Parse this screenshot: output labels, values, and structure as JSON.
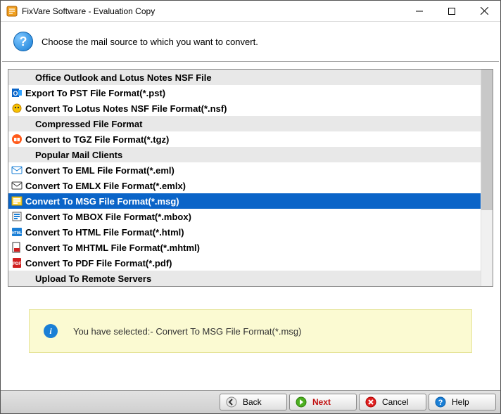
{
  "window": {
    "title": "FixVare Software - Evaluation Copy"
  },
  "header": {
    "prompt": "Choose the mail source to which you want to convert."
  },
  "list": {
    "rows": [
      {
        "kind": "group",
        "label": "Office Outlook and Lotus Notes NSF File"
      },
      {
        "kind": "item",
        "icon": "outlook",
        "label": "Export To PST File Format(*.pst)"
      },
      {
        "kind": "item",
        "icon": "lotus",
        "label": "Convert To Lotus Notes NSF File Format(*.nsf)"
      },
      {
        "kind": "group",
        "label": "Compressed File Format"
      },
      {
        "kind": "item",
        "icon": "tgz",
        "label": "Convert to TGZ File Format(*.tgz)"
      },
      {
        "kind": "group",
        "label": "Popular Mail Clients"
      },
      {
        "kind": "item",
        "icon": "eml",
        "label": "Convert To EML File Format(*.eml)"
      },
      {
        "kind": "item",
        "icon": "emlx",
        "label": "Convert To EMLX File Format(*.emlx)"
      },
      {
        "kind": "item",
        "icon": "msg",
        "label": "Convert To MSG File Format(*.msg)",
        "selected": true
      },
      {
        "kind": "item",
        "icon": "mbox",
        "label": "Convert To MBOX File Format(*.mbox)"
      },
      {
        "kind": "item",
        "icon": "html",
        "label": "Convert To HTML File Format(*.html)"
      },
      {
        "kind": "item",
        "icon": "mhtml",
        "label": "Convert To MHTML File Format(*.mhtml)"
      },
      {
        "kind": "item",
        "icon": "pdf",
        "label": "Convert To PDF File Format(*.pdf)"
      },
      {
        "kind": "group",
        "label": "Upload To Remote Servers"
      }
    ]
  },
  "info": {
    "message": "You have selected:- Convert To MSG File Format(*.msg)"
  },
  "footer": {
    "back": "Back",
    "next": "Next",
    "cancel": "Cancel",
    "help": "Help"
  }
}
